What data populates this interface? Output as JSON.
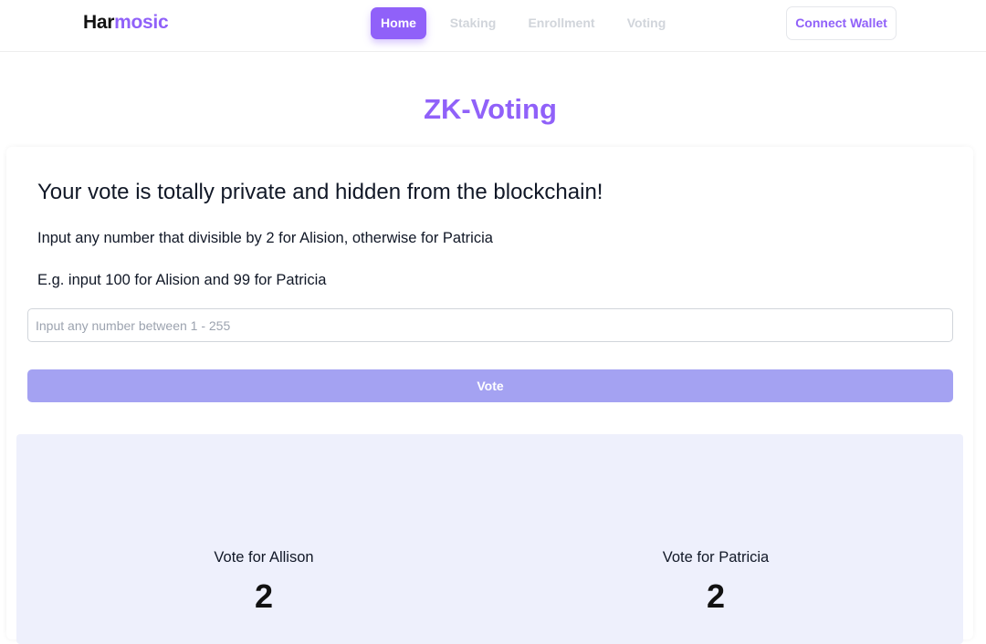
{
  "header": {
    "logo": {
      "part1": "Har",
      "part2": "mosic"
    },
    "nav": {
      "home": "Home",
      "staking": "Staking",
      "enrollment": "Enrollment",
      "voting": "Voting"
    },
    "connect_wallet": "Connect Wallet"
  },
  "main": {
    "title": "ZK-Voting",
    "heading": "Your vote is totally private and hidden from the blockchain!",
    "instruction_1": "Input any number that divisible by 2 for Alision, otherwise for Patricia",
    "instruction_2": "E.g. input 100 for Alision and 99 for Patricia",
    "input": {
      "value": "",
      "placeholder": "Input any number between 1 - 255"
    },
    "vote_button": "Vote"
  },
  "results": {
    "allison": {
      "label": "Vote for Allison",
      "count": "2"
    },
    "patricia": {
      "label": "Vote for Patricia",
      "count": "2"
    }
  },
  "colors": {
    "accent": "#9061f9",
    "vote_button": "#a4a2f2",
    "results_bg": "#eef0fc",
    "nav_inactive": "#d1d5db"
  }
}
